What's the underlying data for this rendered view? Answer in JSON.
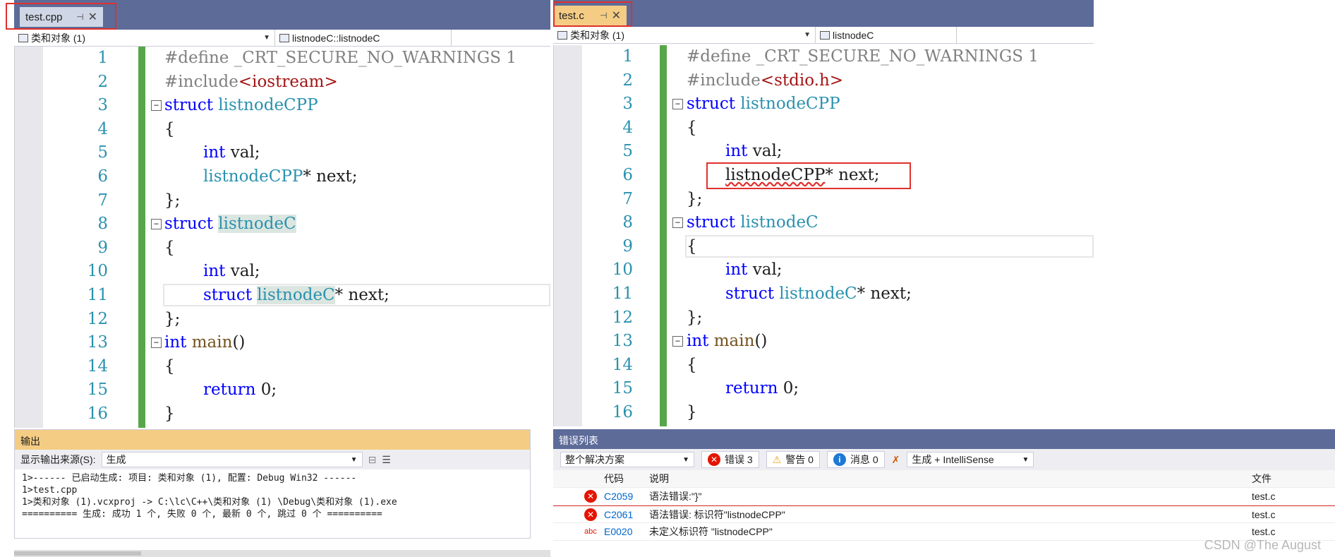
{
  "left": {
    "tab": {
      "label": "test.cpp",
      "pin": "⊣",
      "close": "✕"
    },
    "nav": {
      "scope": "类和对象 (1)",
      "member": "listnodeC::listnodeC"
    },
    "lines": [
      {
        "n": "1"
      },
      {
        "n": "2"
      },
      {
        "n": "3"
      },
      {
        "n": "4"
      },
      {
        "n": "5"
      },
      {
        "n": "6"
      },
      {
        "n": "7"
      },
      {
        "n": "8"
      },
      {
        "n": "9"
      },
      {
        "n": "10"
      },
      {
        "n": "11"
      },
      {
        "n": "12"
      },
      {
        "n": "13"
      },
      {
        "n": "14"
      },
      {
        "n": "15"
      },
      {
        "n": "16"
      }
    ],
    "code": {
      "l1_pp": "#define _CRT_SECURE_NO_WARNINGS 1",
      "l2_pp": "#include",
      "l2_inc": "<iostream>",
      "l3_kw": "struct",
      "l3_ty": "listnodeCPP",
      "l4": "{",
      "l5_kw": "int",
      "l5_rest": " val;",
      "l6_ty": "listnodeCPP",
      "l6_rest": "* next;",
      "l7": "};",
      "l8_kw": "struct",
      "l8_ty": "listnodeC",
      "l9": "{",
      "l10_kw": "int",
      "l10_rest": " val;",
      "l11_kw": "struct",
      "l11_ty": "listnodeC",
      "l11_rest": "* next;",
      "l12": "};",
      "l13_kw": "int",
      "l13_fn": "main",
      "l13_rest": "()",
      "l14": "{",
      "l15_kw": "return",
      "l15_rest": " 0;",
      "l16": "}"
    },
    "output": {
      "title": "输出",
      "source_label": "显示输出来源(S):",
      "source_value": "生成",
      "lines": [
        "1>------ 已启动生成: 项目: 类和对象 (1), 配置: Debug Win32 ------",
        "1>test.cpp",
        "1>类和对象 (1).vcxproj -> C:\\lc\\C++\\类和对象 (1) \\Debug\\类和对象 (1).exe",
        "========== 生成: 成功 1 个, 失败 0 个, 最新 0 个, 跳过 0 个 =========="
      ]
    }
  },
  "right": {
    "tab": {
      "label": "test.c",
      "pin": "⊣",
      "close": "✕"
    },
    "nav": {
      "scope": "类和对象 (1)",
      "member": "listnodeC"
    },
    "code": {
      "l1_pp": "#define _CRT_SECURE_NO_WARNINGS 1",
      "l2_pp": "#include",
      "l2_inc": "<stdio.h>",
      "l3_kw": "struct",
      "l3_ty": "listnodeCPP",
      "l4": "{",
      "l5_kw": "int",
      "l5_rest": " val;",
      "l6_err": "listnodeCPP",
      "l6_rest": "* next;",
      "l7": "};",
      "l8_kw": "struct",
      "l8_ty": "listnodeC",
      "l9": "{",
      "l10_kw": "int",
      "l10_rest": " val;",
      "l11_kw": "struct",
      "l11_ty": "listnodeC",
      "l11_rest": "* next;",
      "l12": "};",
      "l13_kw": "int",
      "l13_fn": "main",
      "l13_rest": "()",
      "l14": "{",
      "l15_kw": "return",
      "l15_rest": " 0;",
      "l16": "}"
    },
    "errors": {
      "title": "错误列表",
      "scope": "整个解决方案",
      "errors_badge": "错误 3",
      "warnings_badge": "警告 0",
      "messages_badge": "消息 0",
      "build_filter": "生成 + IntelliSense",
      "col_code": "代码",
      "col_desc": "说明",
      "col_file": "文件",
      "rows": [
        {
          "code": "C2059",
          "desc": "语法错误:\"}\"",
          "file": "test.c"
        },
        {
          "code": "C2061",
          "desc": "语法错误: 标识符\"listnodeCPP\"",
          "file": "test.c"
        },
        {
          "code": "E0020",
          "desc": "未定义标识符 \"listnodeCPP\"",
          "file": "test.c"
        }
      ]
    }
  },
  "watermark": "CSDN @The  August",
  "colors": {
    "keyword": "#0000ff",
    "type": "#2b91af",
    "include": "#a31515",
    "error": "#e0302c",
    "gutter_change": "#57a64a"
  }
}
